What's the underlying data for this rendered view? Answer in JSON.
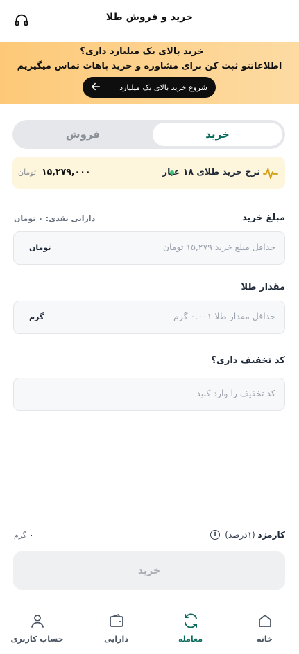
{
  "header": {
    "title": "خرید و فروش طلا",
    "support_icon": "headphones-icon"
  },
  "banner": {
    "line1_prefix": "خرید بالای ",
    "line1_bold": "یک میلیارد",
    "line1_suffix": " داری؟",
    "line2": "اطلاعاتتو ثبت کن برای مشاوره و خرید باهات تماس میگیریم",
    "cta_label": "شروع خرید بالای یک میلیارد",
    "cta_icon": "arrow-left-icon"
  },
  "tabs": {
    "buy": "خرید",
    "sell": "فروش",
    "active": "buy"
  },
  "price": {
    "label": "نرخ خرید طلای ۱۸ عیار",
    "value": "۱۵,۲۷۹,۰۰۰",
    "unit": "تومان",
    "icon": "pulse-icon",
    "live_color": "#34c77b"
  },
  "amount": {
    "title": "مبلغ خرید",
    "balance": "دارایی نقدی: ۰ تومان",
    "placeholder": "حداقل مبلغ خرید ۱۵,۲۷۹ تومان",
    "unit": "تومان"
  },
  "gold": {
    "title": "مقدار طلا",
    "placeholder": "حداقل مقدار طلا ۰.۰۰۱ گرم",
    "unit": "گرم"
  },
  "discount": {
    "title": "کد تخفیف داری؟",
    "placeholder": "کد تخفیف را وارد کنید"
  },
  "fee": {
    "label": "کارمزد",
    "percent": " (۱درصد)",
    "value": "۰",
    "unit": "گرم",
    "info_icon": "info-icon"
  },
  "submit_label": "خرید",
  "nav": {
    "items": [
      {
        "label": "خانه",
        "icon": "home-icon"
      },
      {
        "label": "معامله",
        "icon": "swap-icon",
        "active": true
      },
      {
        "label": "دارایی",
        "icon": "wallet-icon"
      },
      {
        "label": "حساب کاربری",
        "icon": "user-icon"
      }
    ]
  },
  "colors": {
    "accent": "#0b6b5c",
    "banner_start": "#fdc978",
    "banner_end": "#fddba3",
    "price_bg": "#fdf6dc"
  }
}
